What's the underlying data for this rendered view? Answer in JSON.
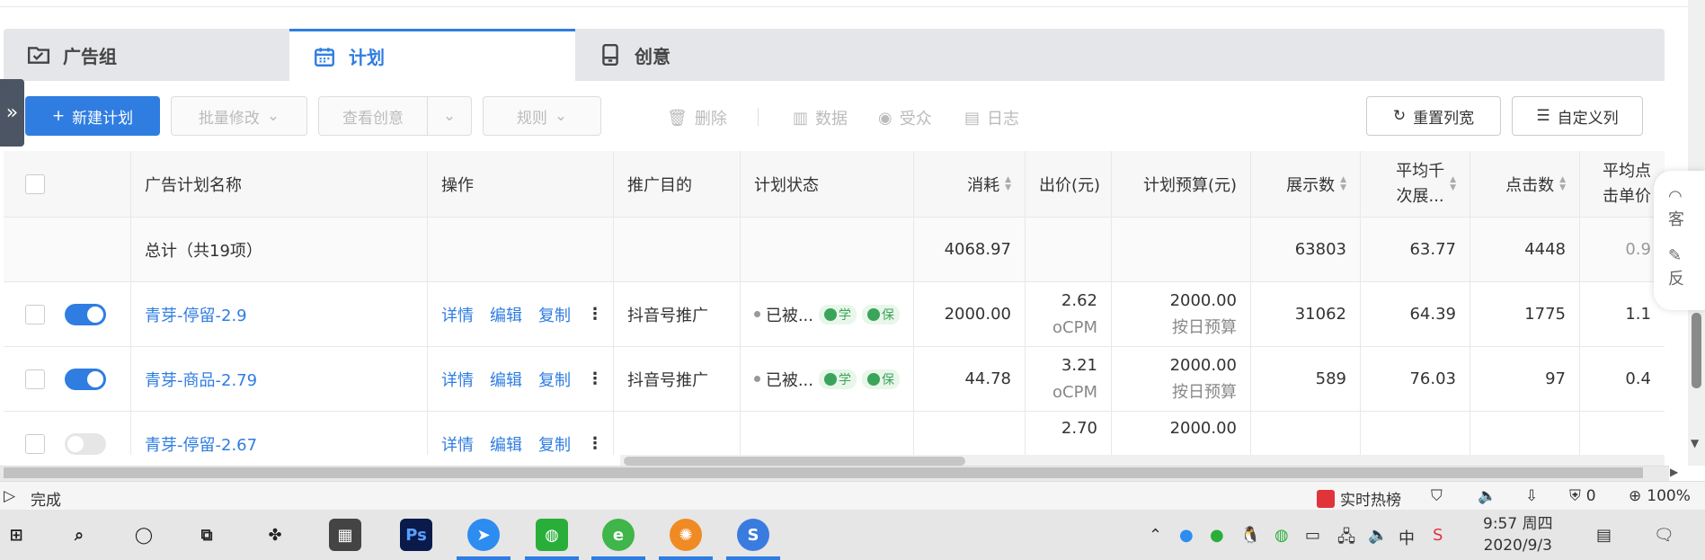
{
  "tabs": [
    {
      "label": "广告组",
      "icon": "folder-check-icon",
      "active": false
    },
    {
      "label": "计划",
      "icon": "calendar-icon",
      "active": true
    },
    {
      "label": "创意",
      "icon": "tablet-icon",
      "active": false
    }
  ],
  "toolbar": {
    "new_plan": "新建计划",
    "batch_edit": "批量修改",
    "view_creative": "查看创意",
    "rules": "规则",
    "delete": "删除",
    "data": "数据",
    "audience": "受众",
    "log": "日志",
    "reset_width": "重置列宽",
    "custom_columns": "自定义列"
  },
  "columns": {
    "name": "广告计划名称",
    "ops": "操作",
    "goal": "推广目的",
    "status": "计划状态",
    "cost": "消耗",
    "bid": "出价(元)",
    "budget": "计划预算(元)",
    "impressions": "展示数",
    "cpm_line1": "平均千",
    "cpm_line2": "次展...",
    "clicks": "点击数",
    "cpc_line1": "平均点",
    "cpc_line2": "击单价"
  },
  "total": {
    "label": "总计（共19项）",
    "cost": "4068.97",
    "impressions": "63803",
    "cpm": "63.77",
    "clicks": "4448",
    "cpc": "0.9"
  },
  "rows": [
    {
      "enabled": true,
      "name": "青芽-停留-2.9",
      "op1": "详情",
      "op2": "编辑",
      "op3": "复制",
      "goal": "抖音号推广",
      "status": "已被...",
      "badge1": "学",
      "badge2": "保",
      "cost": "2000.00",
      "bid": "2.62",
      "bid_type": "oCPM",
      "budget": "2000.00",
      "budget_type": "按日预算",
      "impressions": "31062",
      "cpm": "64.39",
      "clicks": "1775",
      "cpc": "1.1"
    },
    {
      "enabled": true,
      "name": "青芽-商品-2.79",
      "op1": "详情",
      "op2": "编辑",
      "op3": "复制",
      "goal": "抖音号推广",
      "status": "已被...",
      "badge1": "学",
      "badge2": "保",
      "cost": "44.78",
      "bid": "3.21",
      "bid_type": "oCPM",
      "budget": "2000.00",
      "budget_type": "按日预算",
      "impressions": "589",
      "cpm": "76.03",
      "clicks": "97",
      "cpc": "0.4"
    },
    {
      "enabled": false,
      "name": "青芽-停留-2.67",
      "op1": "详情",
      "op2": "编辑",
      "op3": "复制",
      "goal": "",
      "status": "",
      "badge1": "",
      "badge2": "",
      "cost": "",
      "bid": "2.70",
      "bid_type": "",
      "budget": "2000.00",
      "budget_type": "",
      "impressions": "",
      "cpm": "",
      "clicks": "",
      "cpc": ""
    }
  ],
  "float_panel": {
    "line1": "客",
    "line2": "反"
  },
  "status_bar": {
    "done": "完成",
    "hot": "实时热榜",
    "ad_count": "0",
    "zoom": "100%"
  },
  "taskbar": {
    "time": "9:57 周四",
    "date": "2020/9/3",
    "ime": "中",
    "ps_label": "Ps"
  },
  "colors": {
    "accent": "#2f7de1",
    "success": "#3aa55a",
    "hot_red": "#e0343a"
  }
}
